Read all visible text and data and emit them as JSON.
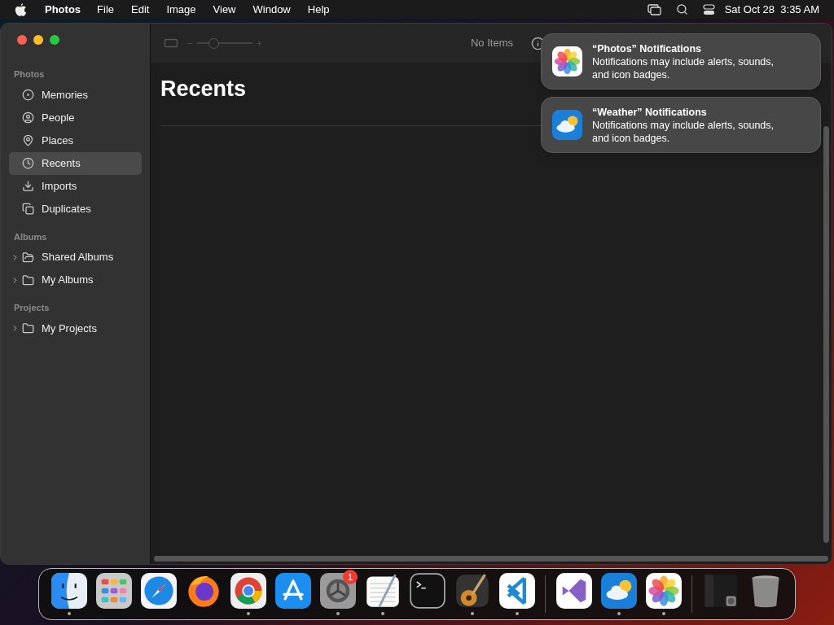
{
  "menu_bar": {
    "app": "Photos",
    "menus": [
      "File",
      "Edit",
      "Image",
      "View",
      "Window",
      "Help"
    ],
    "clock": "Sat Oct 28  3:35 AM"
  },
  "toolbar": {
    "zoom_slider": {
      "level": 0.3
    },
    "status": "No Items"
  },
  "sidebar": {
    "sections": [
      {
        "title": "Photos",
        "items": [
          {
            "kind": "memories",
            "label": "Memories",
            "selected": false
          },
          {
            "kind": "people",
            "label": "People",
            "selected": false
          },
          {
            "kind": "places",
            "label": "Places",
            "selected": false
          },
          {
            "kind": "recents",
            "label": "Recents",
            "selected": true
          },
          {
            "kind": "imports",
            "label": "Imports",
            "selected": false
          },
          {
            "kind": "duplicates",
            "label": "Duplicates",
            "selected": false
          }
        ]
      },
      {
        "title": "Albums",
        "items": [
          {
            "kind": "shared",
            "label": "Shared Albums",
            "selected": false,
            "expanded": false
          },
          {
            "kind": "folder",
            "label": "My Albums",
            "selected": false,
            "expanded": false
          }
        ]
      },
      {
        "title": "Projects",
        "items": [
          {
            "kind": "folder",
            "label": "My Projects",
            "selected": false,
            "expanded": false
          }
        ]
      }
    ]
  },
  "content": {
    "title": "Recents"
  },
  "notifications": [
    {
      "kind": "photos",
      "title": "“Photos” Notifications",
      "body": "Notifications may include alerts, sounds, and icon badges."
    },
    {
      "kind": "weather",
      "title": "“Weather” Notifications",
      "body": "Notifications may include alerts, sounds, and icon badges."
    }
  ],
  "dock": [
    {
      "kind": "finder",
      "running": true
    },
    {
      "kind": "launchpad",
      "running": false
    },
    {
      "kind": "safari",
      "running": false
    },
    {
      "kind": "firefox",
      "running": false
    },
    {
      "kind": "chrome",
      "running": true
    },
    {
      "kind": "appstore",
      "running": false
    },
    {
      "kind": "settings",
      "running": true,
      "badge": "1"
    },
    {
      "kind": "textedit",
      "running": true
    },
    {
      "kind": "terminal",
      "running": false
    },
    {
      "kind": "garageband",
      "running": true
    },
    {
      "kind": "vscode",
      "running": true
    },
    {
      "kind": "separator"
    },
    {
      "kind": "visualstudio",
      "running": false
    },
    {
      "kind": "weather",
      "running": true
    },
    {
      "kind": "photos",
      "running": true
    },
    {
      "kind": "separator"
    },
    {
      "kind": "window",
      "running": false
    },
    {
      "kind": "trash",
      "running": false
    }
  ]
}
